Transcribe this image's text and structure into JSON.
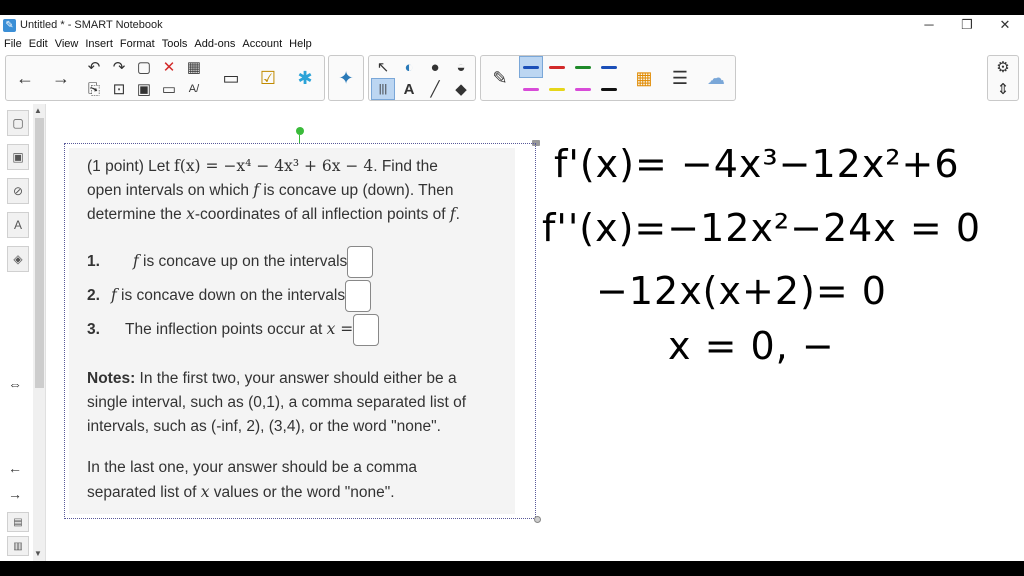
{
  "window": {
    "title": "Untitled * - SMART Notebook",
    "controls": [
      "─",
      "❐",
      "✕"
    ]
  },
  "menu": [
    "File",
    "Edit",
    "View",
    "Insert",
    "Format",
    "Tools",
    "Add-ons",
    "Account",
    "Help"
  ],
  "toolbar": {
    "back_icon": "←",
    "forward_icon": "→",
    "undo_icon": "↶",
    "redo_icon": "↷",
    "delete_icon": "✕",
    "table_icon": "▦",
    "screen_icon": "▭",
    "check_icon": "☑",
    "addon_icon": "✱",
    "select_icon": "↖",
    "text_icon": "A",
    "line_icon": "╱",
    "eraser_icon": "◆",
    "pen_icon": "✎",
    "settings_icon": "⚙",
    "move_icon": "⇕",
    "pen_colors": [
      "#1b4fb8",
      "#d22a2a",
      "#1f8a2a",
      "#1b4fb8",
      "#d84bd8",
      "#e6d619",
      "#d84bd8",
      "#111111"
    ]
  },
  "sidebar": {
    "tabs": [
      "▢",
      "▣",
      "⊘",
      "A",
      "◈"
    ],
    "swap_icon": "⇔",
    "prev_icon": "←",
    "next_icon": "→"
  },
  "problem": {
    "line1_a": "(1 point) Let ",
    "line1_math": "f(x) = −x⁴ − 4x³ + 6x − 4",
    "line1_b": ". Find the",
    "line2_a": "open intervals on which ",
    "line2_f": "f",
    "line2_b": " is concave up (down). Then",
    "line3_a": "determine the ",
    "line3_x": "x",
    "line3_b": "-coordinates of all inflection points of ",
    "line3_f": "f",
    "line3_c": ".",
    "items": [
      {
        "num": "1.",
        "var": "f",
        "text": " is concave up on the intervals"
      },
      {
        "num": "2.",
        "var": "f",
        "text": " is concave down on the intervals"
      },
      {
        "num": "3.",
        "var": "",
        "text": "The inflection points occur at ",
        "tail": "x ="
      }
    ],
    "notes_label": "Notes:",
    "notes_l1": " In the first two, your answer should either be a",
    "notes_l2": "single interval, such as (0,1), a comma separated list of",
    "notes_l3": "intervals, such as (-inf, 2), (3,4), or the word \"none\".",
    "last_l1": "In the last one, your answer should be a comma",
    "last_l2a": "separated list of ",
    "last_l2x": "x",
    "last_l2b": " values or the word \"none\"."
  },
  "handwriting": {
    "line1": "f'(x)= −4x³−12x²+6",
    "line2": "f''(x)=−12x²−24x = 0",
    "line3": "−12x(x+2)= 0",
    "line4": "x = 0, −"
  }
}
